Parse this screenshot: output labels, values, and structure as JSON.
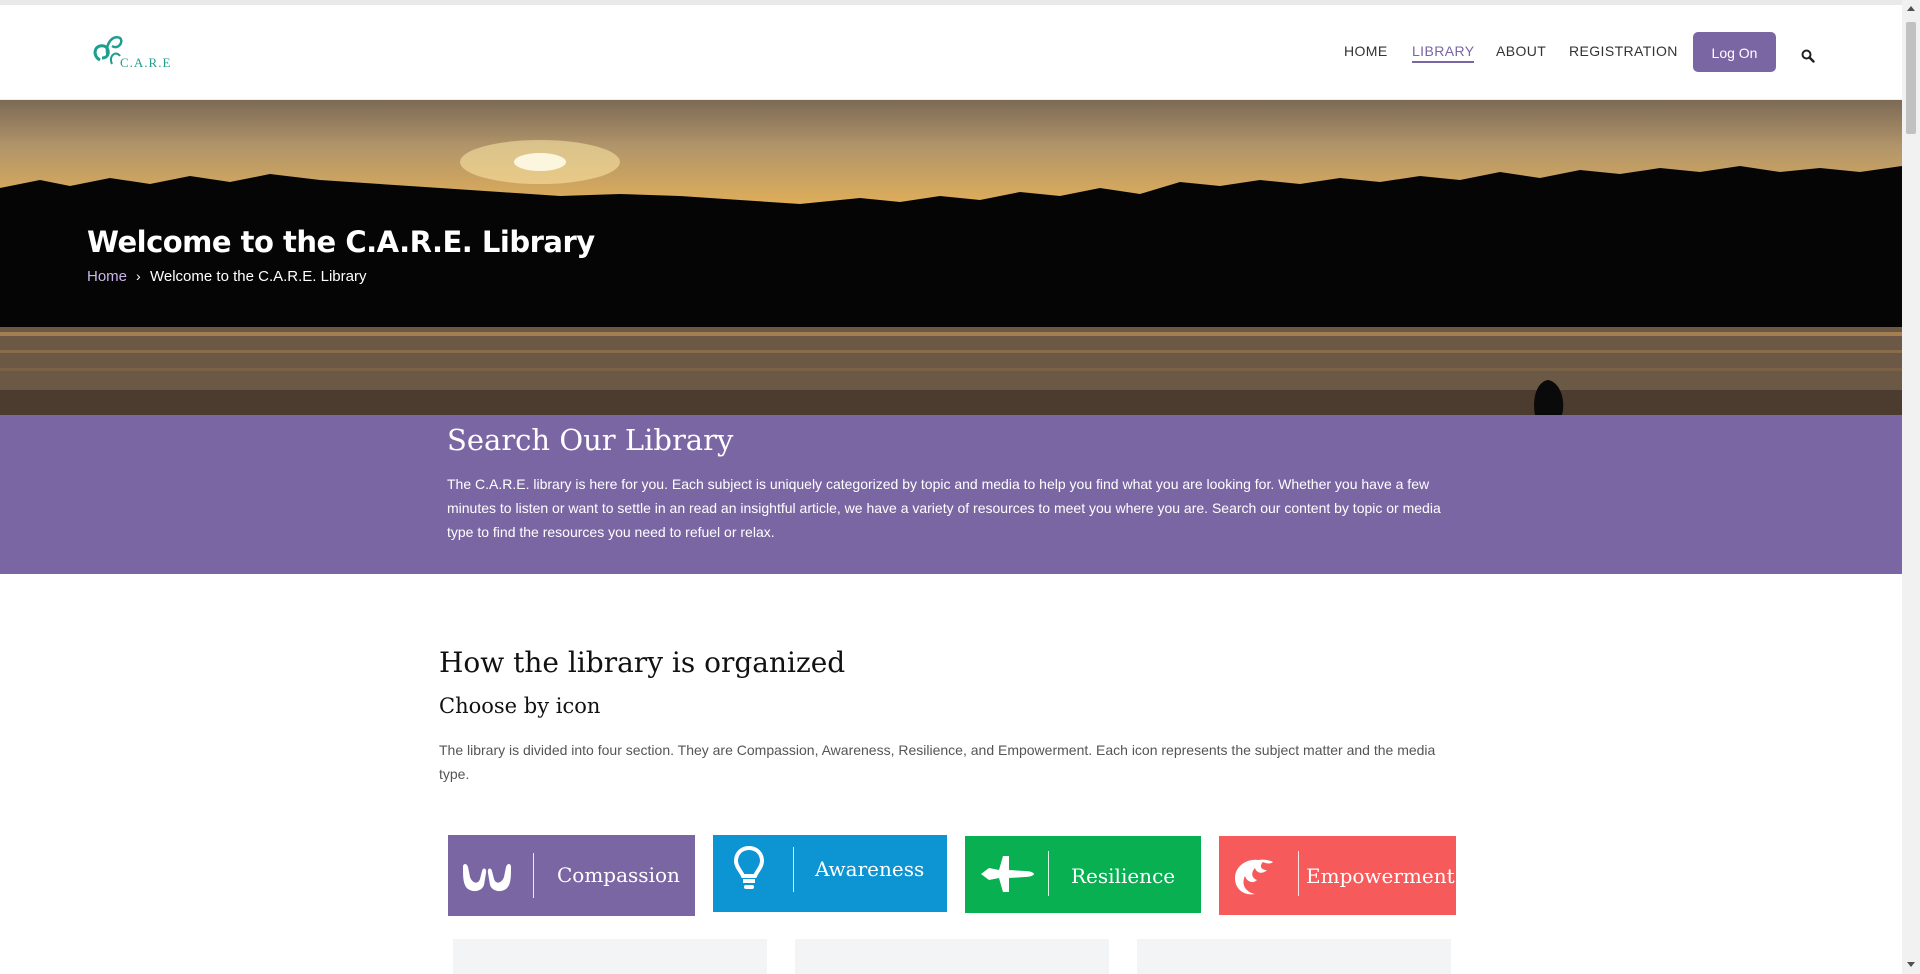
{
  "header": {
    "logo_text": "C.A.R.E",
    "nav": [
      "HOME",
      "LIBRARY",
      "ABOUT",
      "REGISTRATION"
    ],
    "login_label": "Log On",
    "active_nav": "LIBRARY"
  },
  "hero": {
    "title": "Welcome to the C.A.R.E. Library",
    "breadcrumb_home": "Home",
    "breadcrumb_sep": "›",
    "breadcrumb_current": "Welcome to the C.A.R.E. Library"
  },
  "search_section": {
    "title": "Search Our Library",
    "text": "The C.A.R.E. library is here for you. Each subject is uniquely categorized by topic and media to help you find what you are looking for. Whether you have a few minutes to listen or want to settle in an read an insightful article, we have a variety of resources to meet you where you are. Search our content by topic or media type to find the resources you need to refuel or relax."
  },
  "organization": {
    "title": "How the library is organized",
    "subtitle": "Choose by icon",
    "text": "The library is divided into four section. They are Compassion, Awareness, Resilience, and Empowerment. Each icon represents the subject matter and the media type."
  },
  "categories": [
    {
      "label": "Compassion",
      "color": "#7b66a4",
      "icon": "hands-icon"
    },
    {
      "label": "Awareness",
      "color": "#0d94d2",
      "icon": "lightbulb-icon"
    },
    {
      "label": "Resilience",
      "color": "#08b052",
      "icon": "jet-icon"
    },
    {
      "label": "Empowerment",
      "color": "#f75a5a",
      "icon": "phoenix-icon"
    }
  ],
  "colors": {
    "brand_purple": "#7b66a4",
    "logo_teal": "#1e9e8d"
  }
}
